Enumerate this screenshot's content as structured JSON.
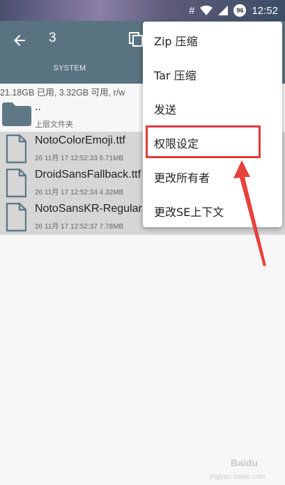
{
  "status_bar": {
    "hash": "#",
    "badge": "96",
    "time": "12:52"
  },
  "toolbar": {
    "title": "3",
    "tab": "SYSTEM"
  },
  "storage_info": "21.18GB 已用, 3.32GB 可用, r/w",
  "parent_folder": {
    "name": "..",
    "label": "上层文件夹"
  },
  "files": [
    {
      "name": "NotoColorEmoji.ttf",
      "meta": "26 11月 17 12:52:33  5.71MB"
    },
    {
      "name": "DroidSansFallback.ttf",
      "meta": "26 11月 17 12:52:34  4.32MB"
    },
    {
      "name": "NotoSansKR-Regular",
      "meta": "26 11月 17 12:52:37  7.78MB"
    }
  ],
  "menu": {
    "items": [
      "Zip 压缩",
      "Tar 压缩",
      "发送",
      "权限设定",
      "更改所有者",
      "更改SE上下文"
    ],
    "highlighted_index": 3
  },
  "watermark": {
    "logo": "Baidu",
    "sub": "jingyan.baidu.com"
  },
  "colors": {
    "toolbar": "#5a7381",
    "selected_row": "#d6d6d6",
    "highlight": "#e03a3a",
    "file_icon": "#5f7886"
  }
}
